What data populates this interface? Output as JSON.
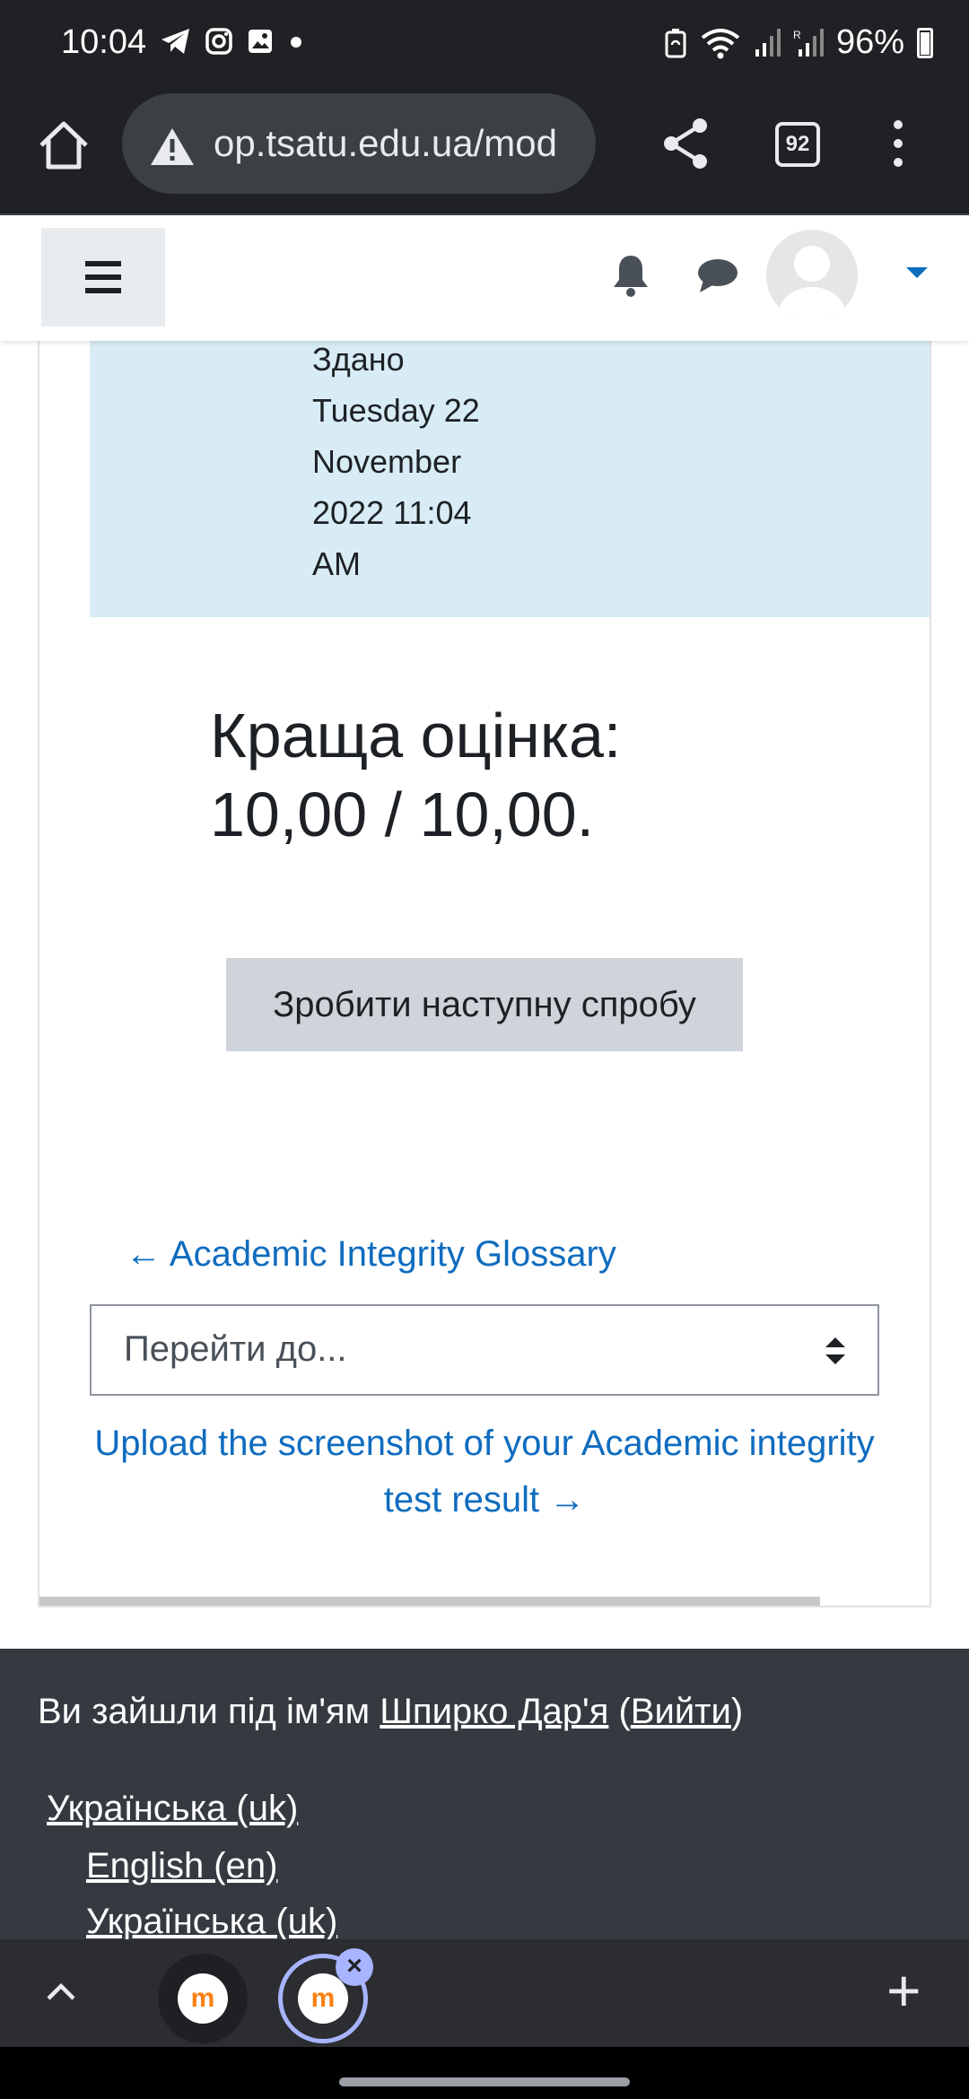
{
  "status_bar": {
    "time": "10:04",
    "battery": "96%",
    "left_icons": [
      "telegram-icon",
      "instagram-icon",
      "gallery-icon",
      "dot-icon"
    ],
    "right_icons": [
      "battery-saver-icon",
      "wifi-icon",
      "signal-icon",
      "signal-r-icon",
      "battery-icon"
    ]
  },
  "browser": {
    "url": "op.tsatu.edu.ua/mod",
    "tab_count": "92"
  },
  "quiz": {
    "submitted_lines": [
      "Здано",
      "Tuesday 22",
      "November",
      "2022 11:04",
      "AM"
    ],
    "best_grade_line1": "Краща оцінка:",
    "best_grade_line2": "10,00 / 10,00.",
    "retry_button": "Зробити наступну спробу"
  },
  "activity_nav": {
    "prev_arrow": "←",
    "prev_label": "Academic Integrity Glossary",
    "jump_placeholder": "Перейти до...",
    "next_label": "Upload the screenshot of your Academic integrity test result",
    "next_arrow": "→"
  },
  "footer": {
    "logged_in_prefix": "Ви зайшли під ім'ям ",
    "user_name": "Шпирко Дар'я",
    "logout_open": " (",
    "logout_label": "Вийти",
    "logout_close": ")",
    "language_current": "Українська (uk)",
    "languages": [
      "English (en)",
      "Українська (uk)"
    ]
  },
  "tab_strip": {
    "favicon_letter": "m",
    "close_symbol": "×",
    "new_tab_symbol": "+"
  },
  "colors": {
    "link": "#0f6cbf",
    "info_box": "#d8ecf5",
    "footer_bg": "#343a40",
    "button_bg": "#ced4da"
  }
}
